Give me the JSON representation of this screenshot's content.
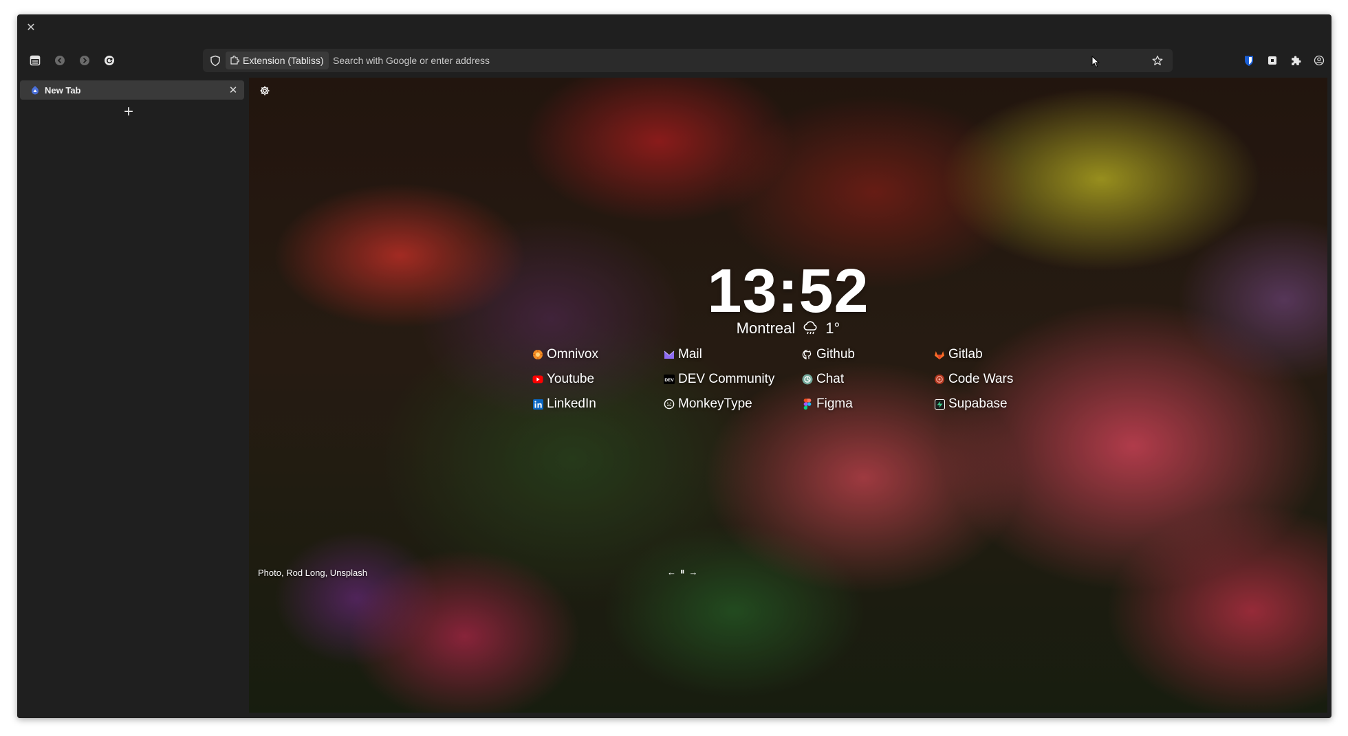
{
  "window": {
    "close_glyph": "✕"
  },
  "toolbar": {
    "icons": [
      "sidebar-icon",
      "back-icon",
      "forward-icon",
      "reload-icon"
    ],
    "url": {
      "extension_label": "Extension (Tabliss)",
      "placeholder": "Search with Google or enter address"
    },
    "right_icons": [
      "bitwarden-icon",
      "container-icon",
      "extensions-icon",
      "account-icon"
    ]
  },
  "sidebar": {
    "tabs": [
      {
        "label": "New Tab",
        "close_glyph": "✕"
      }
    ],
    "new_tab_glyph": "+"
  },
  "newtab": {
    "time": "13:52",
    "weather": {
      "city": "Montreal",
      "temp": "1°",
      "icon": "cloud-rain-icon"
    },
    "links": [
      {
        "label": "Omnivox",
        "icon": "omnivox-icon",
        "color": "#f28b24"
      },
      {
        "label": "Mail",
        "icon": "proton-mail-icon",
        "color": "#8e6cf2"
      },
      {
        "label": "Github",
        "icon": "github-icon",
        "color": "#ffffff"
      },
      {
        "label": "Gitlab",
        "icon": "gitlab-icon",
        "color": "#fc6d26"
      },
      {
        "label": "Youtube",
        "icon": "youtube-icon",
        "color": "#ff0000"
      },
      {
        "label": "DEV Community",
        "icon": "dev-icon",
        "color": "#000000"
      },
      {
        "label": "Chat",
        "icon": "chatgpt-icon",
        "color": "#74aa9c"
      },
      {
        "label": "Code Wars",
        "icon": "codewars-icon",
        "color": "#d94a3b"
      },
      {
        "label": "LinkedIn",
        "icon": "linkedin-icon",
        "color": "#0a66c2"
      },
      {
        "label": "MonkeyType",
        "icon": "monkeytype-icon",
        "color": "#ffffff"
      },
      {
        "label": "Figma",
        "icon": "figma-icon",
        "color": "#a259ff"
      },
      {
        "label": "Supabase",
        "icon": "supabase-icon",
        "color": "#3ecf8e"
      }
    ],
    "credit": "Photo, Rod Long, Unsplash",
    "bg_controls": {
      "prev": "←",
      "pause": "⏸",
      "next": "→"
    }
  }
}
